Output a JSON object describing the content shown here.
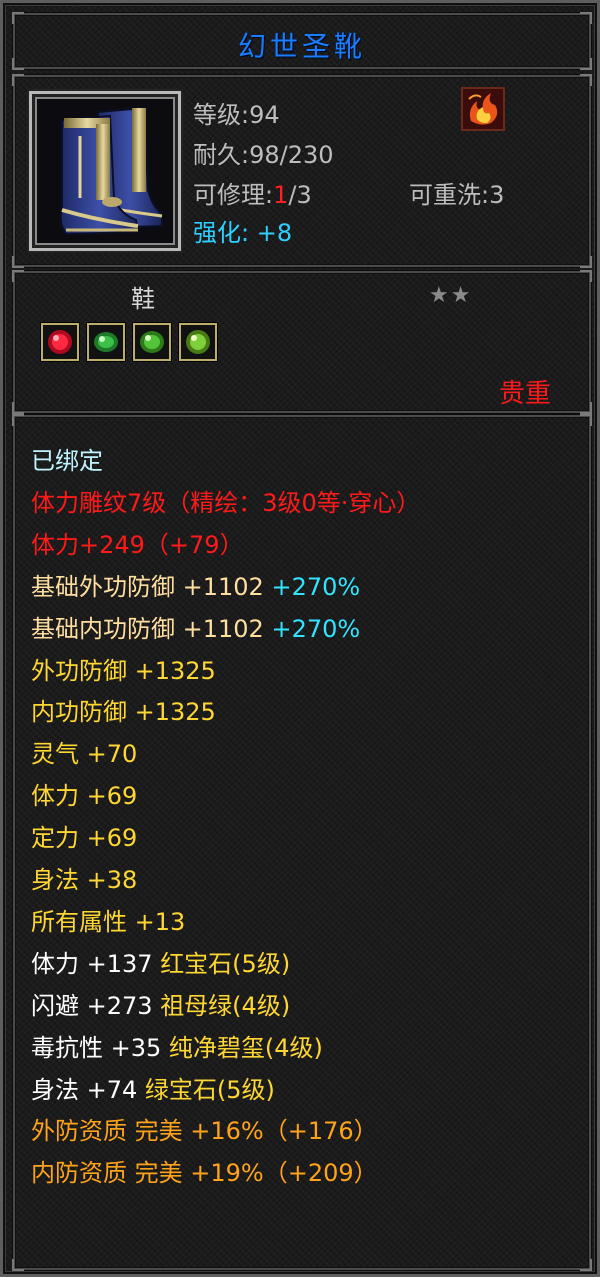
{
  "title": "幻世圣靴",
  "header": {
    "level_label": "等级",
    "level_value": ":94",
    "durability_label": "耐久",
    "durability_value": ":98/230",
    "repair_label": "可修理:",
    "repair_current": "1",
    "repair_max": "/3",
    "rewash_label": "可重洗",
    "rewash_value": ":3",
    "enhance_label": "强化:",
    "enhance_value": "+8",
    "item_icon": "blue-gold-boots-icon",
    "class_icon": "fire-swirl-icon"
  },
  "gems": {
    "equip_type": "鞋",
    "stars": "★★",
    "rarity": "贵重",
    "slots": [
      {
        "icon": "red-gem-icon",
        "color": "#e01030"
      },
      {
        "icon": "green-gem-icon",
        "color": "#3cc04a"
      },
      {
        "icon": "green-gem-icon",
        "color": "#52c43a"
      },
      {
        "icon": "green-gem-icon",
        "color": "#7ed03a"
      }
    ]
  },
  "attributes": [
    {
      "parts": [
        {
          "text": "已绑定",
          "color": "lightcyan"
        }
      ]
    },
    {
      "parts": [
        {
          "text": "体力雕纹7级（精绘：3级0等·穿心）",
          "color": "red2"
        }
      ]
    },
    {
      "parts": [
        {
          "text": "体力+249（+79）",
          "color": "red2"
        }
      ]
    },
    {
      "parts": [
        {
          "text": "基础外功防御 +1102 ",
          "color": "beige"
        },
        {
          "text": "+270%",
          "color": "cyan"
        }
      ]
    },
    {
      "parts": [
        {
          "text": "基础内功防御 +1102 ",
          "color": "beige"
        },
        {
          "text": "+270%",
          "color": "cyan"
        }
      ]
    },
    {
      "parts": [
        {
          "text": "外功防御 +1325",
          "color": "yellow"
        }
      ]
    },
    {
      "parts": [
        {
          "text": "内功防御 +1325",
          "color": "yellow"
        }
      ]
    },
    {
      "parts": [
        {
          "text": "灵气 +70",
          "color": "yellow"
        }
      ]
    },
    {
      "parts": [
        {
          "text": "体力 +69",
          "color": "yellow"
        }
      ]
    },
    {
      "parts": [
        {
          "text": "定力 +69",
          "color": "yellow"
        }
      ]
    },
    {
      "parts": [
        {
          "text": "身法 +38",
          "color": "yellow"
        }
      ]
    },
    {
      "parts": [
        {
          "text": "所有属性 +13",
          "color": "yellow"
        }
      ]
    },
    {
      "parts": [
        {
          "text": "体力 +137 ",
          "color": "white"
        },
        {
          "text": "红宝石(5级)",
          "color": "yellow"
        }
      ]
    },
    {
      "parts": [
        {
          "text": "闪避 +273 ",
          "color": "white"
        },
        {
          "text": "祖母绿(4级)",
          "color": "yellow"
        }
      ]
    },
    {
      "parts": [
        {
          "text": "毒抗性 +35 ",
          "color": "white"
        },
        {
          "text": "纯净碧玺(4级)",
          "color": "yellow"
        }
      ]
    },
    {
      "parts": [
        {
          "text": "身法 +74 ",
          "color": "white"
        },
        {
          "text": "绿宝石(5级)",
          "color": "yellow"
        }
      ]
    },
    {
      "parts": [
        {
          "text": "外防资质  完美 +16%（+176）",
          "color": "orange"
        }
      ]
    },
    {
      "parts": [
        {
          "text": "内防资质  完美 +19%（+209）",
          "color": "orange"
        }
      ]
    }
  ]
}
